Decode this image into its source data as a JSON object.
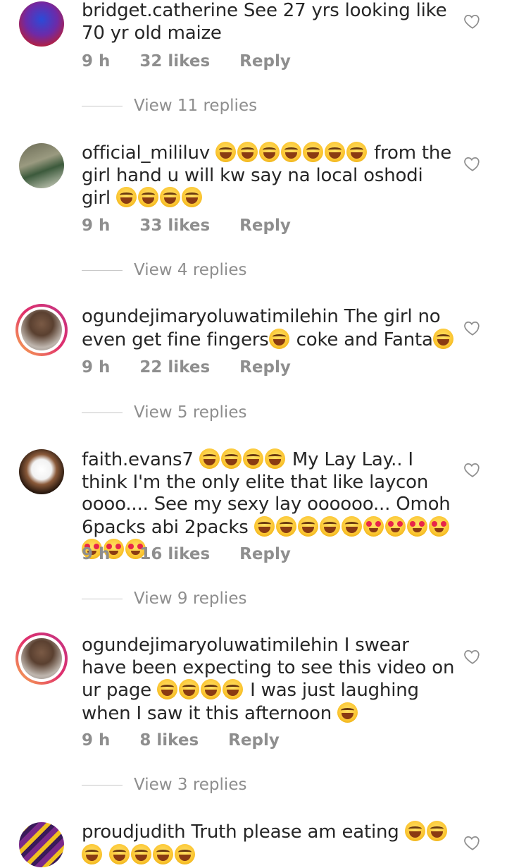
{
  "comments": [
    {
      "username": "bridget.catherine",
      "text": "See 27 yrs looking like 70 yr old maize",
      "time": "9 h",
      "likes": "32 likes",
      "reply": "Reply",
      "view_replies": "View 11 replies"
    },
    {
      "username": "official_mililuv",
      "text_after_emoji": "from the girl hand u will kw say na local oshodi girl",
      "time": "9 h",
      "likes": "33 likes",
      "reply": "Reply",
      "view_replies": "View 4 replies"
    },
    {
      "username": "ogundejimaryoluwatimilehin",
      "text_a": "The girl no even get fine fingers",
      "text_b": "coke and Fanta",
      "time": "9 h",
      "likes": "22 likes",
      "reply": "Reply",
      "view_replies": "View 5 replies"
    },
    {
      "username": "faith.evans7",
      "text_a": "My Lay Lay.. I think I'm the only elite that like laycon oooo.... See my sexy lay oooooo... Omoh 6packs abi 2packs",
      "time": "9 h",
      "likes": "16 likes",
      "reply": "Reply",
      "view_replies": "View 9 replies"
    },
    {
      "username": "ogundejimaryoluwatimilehin",
      "text_a": "I swear have been expecting to see this video on ur page",
      "text_b": "I was just laughing when I saw it this afternoon",
      "time": "9 h",
      "likes": "8 likes",
      "reply": "Reply",
      "view_replies": "View 3 replies"
    },
    {
      "username": "proudjudith",
      "text_a": "Truth please am eating"
    }
  ],
  "icons": {
    "heart": "heart-outline-icon",
    "laugh": "face-with-tears-of-joy-emoji",
    "hearteyes": "heart-eyes-emoji"
  },
  "colors": {
    "text": "#262626",
    "meta": "#8e8e8e",
    "story_ring_start": "#f9b24e",
    "story_ring_end": "#c13584"
  }
}
